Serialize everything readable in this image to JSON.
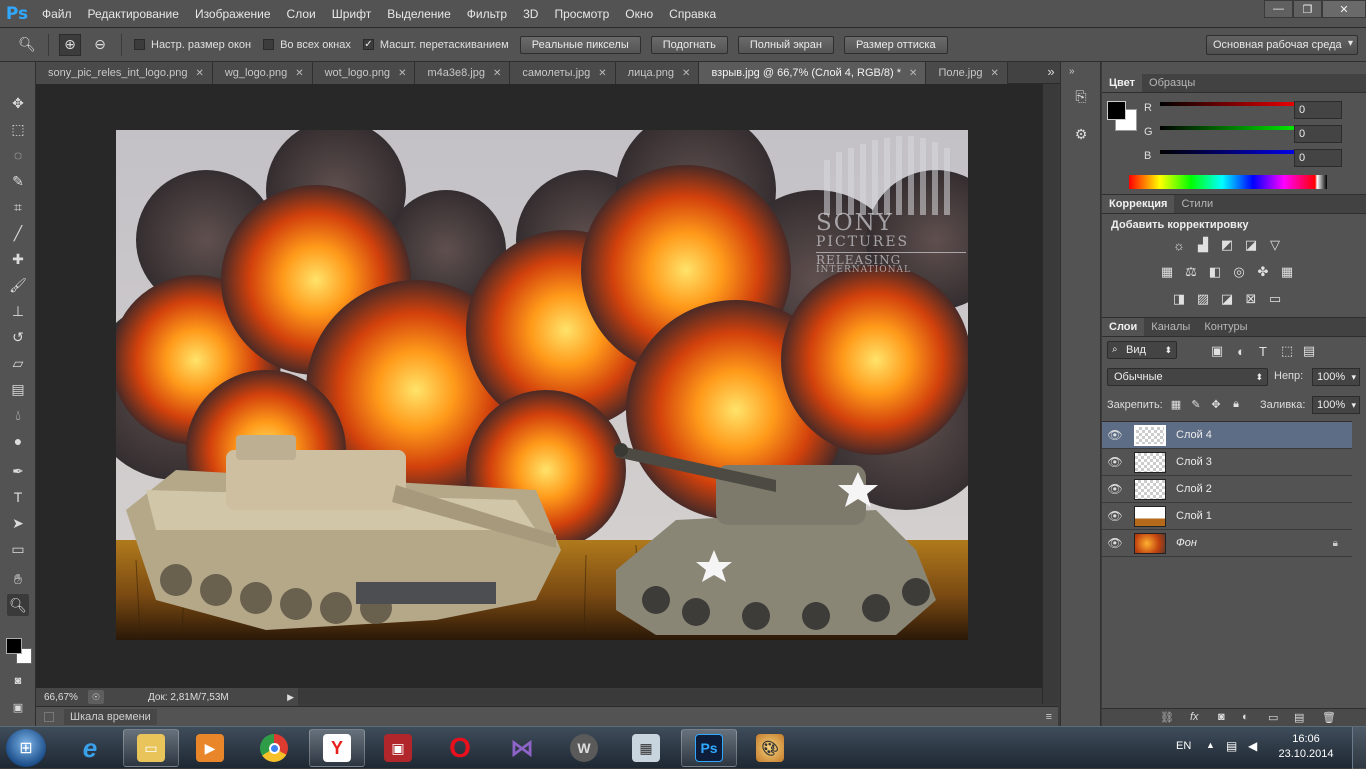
{
  "app": {
    "logo": "Ps"
  },
  "menu": [
    "Файл",
    "Редактирование",
    "Изображение",
    "Слои",
    "Шрифт",
    "Выделение",
    "Фильтр",
    "3D",
    "Просмотр",
    "Окно",
    "Справка"
  ],
  "window_controls": {
    "minimize": "—",
    "restore": "❐",
    "close": "✕"
  },
  "options": {
    "resize_windows": "Настр. размер окон",
    "all_windows": "Во всех окнах",
    "scrubby_zoom": "Масшт. перетаскиванием",
    "actual_pixels": "Реальные пикселы",
    "fit_screen": "Подогнать",
    "fill_screen": "Полный экран",
    "print_size": "Размер оттиска",
    "workspace": "Основная рабочая среда"
  },
  "tabs": [
    {
      "label": "sony_pic_reles_int_logo.png",
      "active": false
    },
    {
      "label": "wg_logo.png",
      "active": false
    },
    {
      "label": "wot_logo.png",
      "active": false
    },
    {
      "label": "m4a3e8.jpg",
      "active": false
    },
    {
      "label": "самолеты.jpg",
      "active": false
    },
    {
      "label": "лица.png",
      "active": false
    },
    {
      "label": "взрыв.jpg @ 66,7% (Слой 4, RGB/8) *",
      "active": true
    },
    {
      "label": "Поле.jpg",
      "active": false
    }
  ],
  "tab_overflow": "»",
  "watermark": {
    "line1": "SONY",
    "line2": "PICTURES",
    "line3": "RELEASING",
    "line4": "INTERNATIONAL"
  },
  "status": {
    "zoom": "66,67%",
    "doc": "Док: 2,81M/7,53M"
  },
  "timeline": {
    "label": "Шкала времени"
  },
  "color_panel": {
    "tabs": [
      "Цвет",
      "Образцы"
    ],
    "channels": [
      {
        "name": "R",
        "value": "0"
      },
      {
        "name": "G",
        "value": "0"
      },
      {
        "name": "B",
        "value": "0"
      }
    ],
    "foreground": "#000000",
    "background": "#ffffff"
  },
  "adjustments_panel": {
    "tabs": [
      "Коррекция",
      "Стили"
    ],
    "title": "Добавить корректировку"
  },
  "layers_panel": {
    "tabs": [
      "Слои",
      "Каналы",
      "Контуры"
    ],
    "filter_kind": "Вид",
    "blend_mode": "Обычные",
    "opacity_label": "Непр:",
    "opacity": "100%",
    "lock_label": "Закрепить:",
    "fill_label": "Заливка:",
    "fill": "100%",
    "layers": [
      {
        "name": "Слой 4",
        "selected": true
      },
      {
        "name": "Слой 3",
        "selected": false
      },
      {
        "name": "Слой 2",
        "selected": false
      },
      {
        "name": "Слой 1",
        "selected": false
      },
      {
        "name": "Фон",
        "selected": false
      }
    ]
  },
  "taskbar": {
    "language": "EN",
    "time": "16:06",
    "date": "23.10.2014"
  },
  "colors": {
    "ui_bg": "#535353",
    "canvas_bg": "#282828",
    "selected_layer": "#5e6d86",
    "ps_blue": "#31a8ff"
  }
}
